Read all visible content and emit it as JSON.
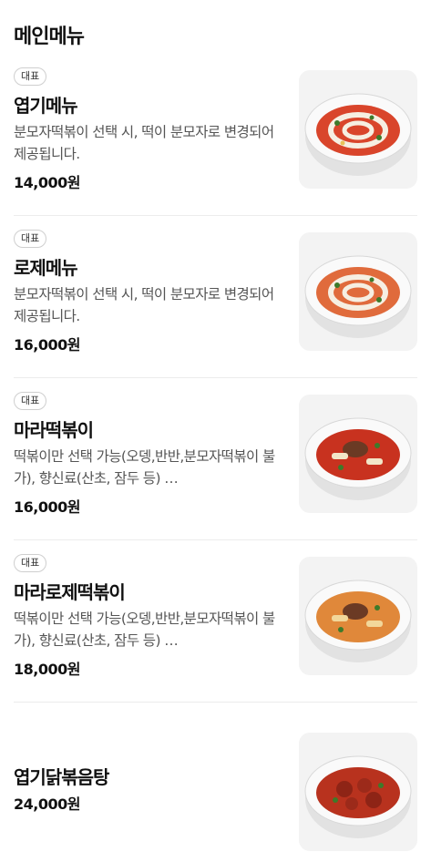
{
  "section": {
    "title": "메인메뉴"
  },
  "items": [
    {
      "badge": "대표",
      "name": "엽기메뉴",
      "description": "분모자떡볶이 선택 시, 떡이 분모자로 변경되어 제공됩니다.",
      "price": "14,000원",
      "image": {
        "icon": "tteokbokki-bowl-icon",
        "sauce": "#d9452b",
        "topping": "cream-swirl"
      }
    },
    {
      "badge": "대표",
      "name": "로제메뉴",
      "description": "분모자떡볶이 선택 시, 떡이 분모자로 변경되어 제공됩니다.",
      "price": "16,000원",
      "image": {
        "icon": "rose-tteokbokki-bowl-icon",
        "sauce": "#e06b3c",
        "topping": "cream-swirl"
      }
    },
    {
      "badge": "대표",
      "name": "마라떡볶이",
      "description": "떡볶이만 선택 가능(오뎅,반반,분모자떡볶이 불가), 향신료(산초, 잠두 등) …",
      "price": "16,000원",
      "image": {
        "icon": "mala-tteokbokki-bowl-icon",
        "sauce": "#c8321f",
        "topping": "beef"
      }
    },
    {
      "badge": "대표",
      "name": "마라로제떡볶이",
      "description": "떡볶이만 선택 가능(오뎅,반반,분모자떡볶이 불가), 향신료(산초, 잠두 등) …",
      "price": "18,000원",
      "image": {
        "icon": "mala-rose-tteokbokki-bowl-icon",
        "sauce": "#e0883a",
        "topping": "beef"
      }
    },
    {
      "badge": "",
      "name": "엽기닭볶음탕",
      "description": "",
      "price": "24,000원",
      "image": {
        "icon": "braised-chicken-bowl-icon",
        "sauce": "#b8321e",
        "topping": "chicken"
      }
    }
  ]
}
